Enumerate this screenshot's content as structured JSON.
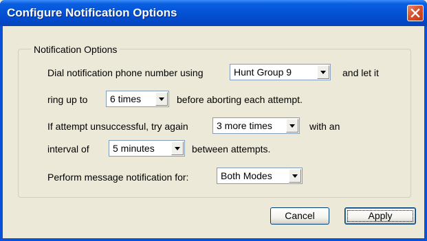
{
  "dialog": {
    "title": "Configure Notification Options",
    "close_icon": "close-icon"
  },
  "group": {
    "label": "Notification Options"
  },
  "row1": {
    "prefix": "Dial notification phone number using",
    "combo_value": "Hunt Group 9",
    "suffix": "and let it"
  },
  "row2": {
    "prefix": "ring up to",
    "combo_value": "6 times",
    "suffix": "before aborting each attempt."
  },
  "row3": {
    "prefix": "If attempt unsuccessful, try again",
    "combo_value": "3 more times",
    "suffix": "with an"
  },
  "row4": {
    "prefix": "interval of",
    "combo_value": "5 minutes",
    "suffix": "between attempts."
  },
  "row5": {
    "prefix": "Perform message notification for:",
    "combo_value": "Both Modes"
  },
  "buttons": {
    "cancel_label": "Cancel",
    "apply_label": "Apply"
  },
  "colors": {
    "titlebar": "#0453d6",
    "close": "#d9502c",
    "face": "#ece9d8"
  }
}
